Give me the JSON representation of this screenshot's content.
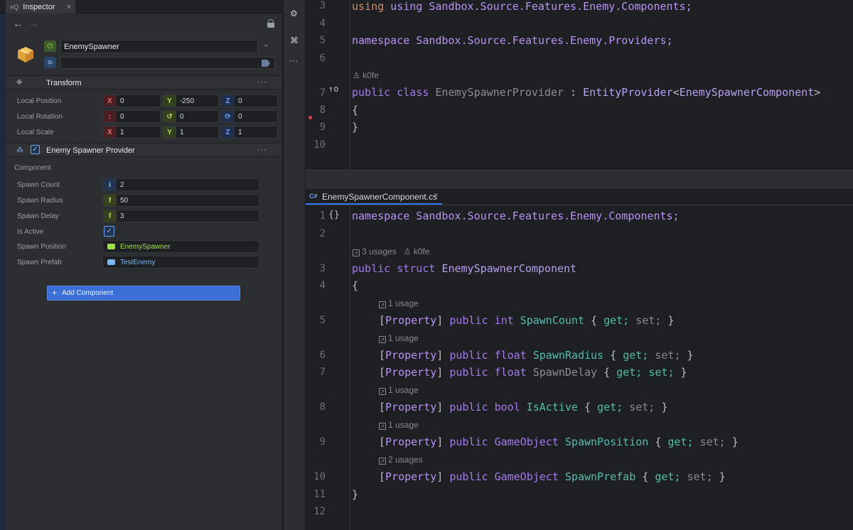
{
  "inspector": {
    "tab_label": "Inspector",
    "tab_close": "×",
    "object_name": "EnemySpawner",
    "tag_value": "",
    "transform": {
      "title": "Transform",
      "menu": "···",
      "rows": [
        {
          "label": "Local Position",
          "x": "0",
          "y": "-250",
          "z": "0"
        },
        {
          "label": "Local Rotation",
          "x": "0",
          "y": "0",
          "z": "0"
        },
        {
          "label": "Local Scale",
          "x": "1",
          "y": "1",
          "z": "1"
        }
      ],
      "axis_letters": {
        "x": "X",
        "y": "Y",
        "z": "Z"
      }
    },
    "component": {
      "title": "Enemy Spawner Provider",
      "menu": "···",
      "heading": "Component",
      "fields": {
        "spawn_count": {
          "label": "Spawn Count",
          "badge": "i",
          "value": "2"
        },
        "spawn_radius": {
          "label": "Spawn Radius",
          "badge": "f",
          "value": "50"
        },
        "spawn_delay": {
          "label": "Spawn Delay",
          "badge": "f",
          "value": "3"
        },
        "is_active": {
          "label": "Is Active",
          "checked": true
        },
        "spawn_position": {
          "label": "Spawn Position",
          "value": "EnemySpawner",
          "color": "#9fe04a"
        },
        "spawn_prefab": {
          "label": "Spawn Prefab",
          "value": "TestEnemy",
          "color": "#7bb8f5"
        }
      }
    },
    "add_component_label": "Add Component"
  },
  "editor": {
    "top_pane": {
      "lines": [
        {
          "n": "3",
          "text": "using Sandbox.Source.Features.Enemy.Components;"
        },
        {
          "n": "4",
          "text": ""
        },
        {
          "n": "5",
          "text": "namespace Sandbox.Source.Features.Enemy.Providers;"
        },
        {
          "n": "6",
          "text": ""
        },
        {
          "n": "7",
          "kw1": "public",
          "kw2": "class",
          "name": "EnemySpawnerProvider",
          "rest_a": " : ",
          "base": "EntityProvider",
          "lt": "<",
          "arg": "EnemySpawnerComponent",
          "gt": ">"
        },
        {
          "n": "8",
          "text": "{"
        },
        {
          "n": "9",
          "text": "}"
        },
        {
          "n": "10",
          "text": ""
        }
      ],
      "author_hint": "k0fe"
    },
    "file_tab": {
      "lang": "C#",
      "name": "EnemySpawnerComponent.cs",
      "close": "×"
    },
    "bottom_pane": {
      "line1": {
        "n": "1",
        "glyph": "{}",
        "text": "namespace Sandbox.Source.Features.Enemy.Components;"
      },
      "line2": {
        "n": "2"
      },
      "usages_hint": "3 usages",
      "author_hint": "k0fe",
      "line3": {
        "n": "3",
        "kw1": "public",
        "kw2": "struct",
        "name": "EnemySpawnerComponent"
      },
      "line4": {
        "n": "4",
        "text": "{"
      },
      "props": [
        {
          "n": "5",
          "hint": "1 usage",
          "attr": "Property",
          "type": "int",
          "name": "SpawnCount"
        },
        {
          "n": "6",
          "hint": "1 usage",
          "attr": "Property",
          "type": "float",
          "name": "SpawnRadius"
        },
        {
          "n": "7",
          "hint": "",
          "attr": "Property",
          "type": "float",
          "name": "SpawnDelay"
        },
        {
          "n": "8",
          "hint": "1 usage",
          "attr": "Property",
          "type": "bool",
          "name": "IsActive"
        },
        {
          "n": "9",
          "hint": "1 usage",
          "attr": "Property",
          "type": "GameObject",
          "name": "SpawnPosition"
        },
        {
          "n": "10",
          "hint": "2 usages",
          "attr": "Property",
          "type": "GameObject",
          "name": "SpawnPrefab"
        }
      ],
      "line11": {
        "n": "11",
        "text": "}"
      },
      "line12": {
        "n": "12"
      },
      "accessor_get": "get;",
      "accessor_set": "set;",
      "public_kw": "public"
    }
  }
}
